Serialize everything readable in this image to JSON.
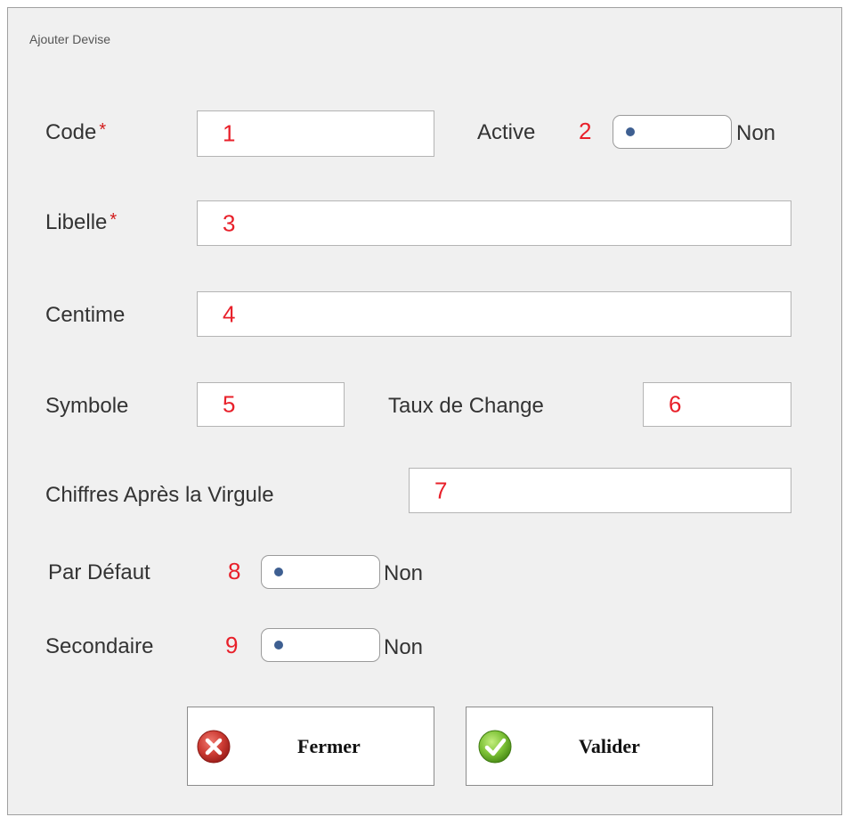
{
  "dialog": {
    "title": "Ajouter Devise"
  },
  "required_marker": "*",
  "fields": {
    "code": {
      "label": "Code",
      "value": "1"
    },
    "active": {
      "label": "Active",
      "number": "2",
      "state": "Non"
    },
    "libelle": {
      "label": "Libelle",
      "value": "3"
    },
    "centime": {
      "label": "Centime",
      "value": "4"
    },
    "symbole": {
      "label": "Symbole",
      "value": "5"
    },
    "taux_de_change": {
      "label": "Taux de Change",
      "value": "6"
    },
    "chiffres_apres_virgule": {
      "label": "Chiffres Après la Virgule",
      "value": "7"
    },
    "par_defaut": {
      "label": "Par Défaut",
      "number": "8",
      "state": "Non"
    },
    "secondaire": {
      "label": "Secondaire",
      "number": "9",
      "state": "Non"
    }
  },
  "buttons": {
    "fermer": {
      "label": "Fermer",
      "icon": "close-x-icon",
      "color": "#c8302c"
    },
    "valider": {
      "label": "Valider",
      "icon": "check-icon",
      "color": "#6fae2a"
    }
  },
  "colors": {
    "annotation_numbers": "#e8202a",
    "required_marker": "#d21b1b",
    "toggle_dot": "#3e5f91"
  }
}
